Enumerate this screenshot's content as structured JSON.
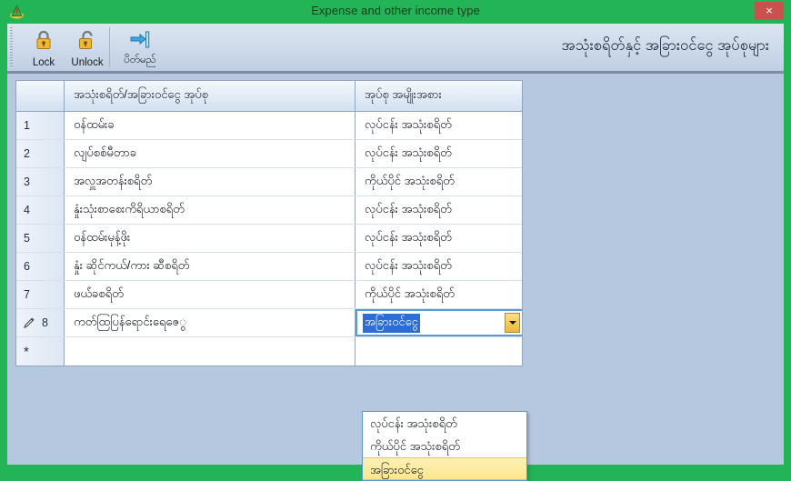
{
  "window": {
    "title": "Expense and other income type",
    "app_icon": "app-icon",
    "close_label": "×",
    "accent_green": "#22b455",
    "close_red": "#c9524f",
    "client_bg": "#b6c8e0"
  },
  "toolbar": {
    "items": [
      {
        "label": "Lock",
        "icon": "lock-closed-icon"
      },
      {
        "label": "Unlock",
        "icon": "lock-open-icon"
      },
      {
        "label": "ပိတ်မည်",
        "icon": "exit-door-icon"
      }
    ],
    "heading": "အသုံးစရိတ်နှင့် အခြားဝင်ငွေ အုပ်စုများ"
  },
  "grid": {
    "columns": [
      "",
      "အသုံးစရိတ်/အခြားဝင်ငွေ အုပ်စု",
      "အုပ်စု အမျိုးအစား"
    ],
    "rows": [
      {
        "num": "1",
        "name": "ဝန်ထမ်းခ",
        "type": "လုပ်ငန်း အသုံးစရိတ်",
        "state": "normal"
      },
      {
        "num": "2",
        "name": "လျပ်စစ်မီတာခ",
        "type": "လုပ်ငန်း အသုံးစရိတ်",
        "state": "normal"
      },
      {
        "num": "3",
        "name": "အလှူအတန်းစရိတ်",
        "type": "ကိုယ်ပိုင် အသုံးစရိတ်",
        "state": "normal"
      },
      {
        "num": "4",
        "name": "နှုံးသုံးစာစေးကိရိယာစရိတ်",
        "type": "လုပ်ငန်း အသုံးစရိတ်",
        "state": "normal"
      },
      {
        "num": "5",
        "name": "ဝန်ထမ်းမုန့်ဖိုး",
        "type": "လုပ်ငန်း အသုံးစရိတ်",
        "state": "normal"
      },
      {
        "num": "6",
        "name": "နှုံး ဆိုင်ကယ်/ကား ဆီစရိတ်",
        "type": "လုပ်ငန်း အသုံးစရိတ်",
        "state": "normal"
      },
      {
        "num": "7",
        "name": "ဖယ်ံခစရိတ်",
        "type": "ကိုယ်ပိုင် အသုံးစရိတ်",
        "state": "normal"
      },
      {
        "num": "8",
        "name": "ကတ်ထြပြန်ရောင်းရေဇေွ",
        "type": "",
        "state": "editing"
      },
      {
        "num": "*",
        "name": "",
        "type": "",
        "state": "new"
      }
    ]
  },
  "combo": {
    "value": "အခြားဝင်ငွေ",
    "arrow_icon": "chevron-down-icon",
    "options": [
      {
        "label": "လုပ်ငန်း အသုံးစရိတ်",
        "selected": false
      },
      {
        "label": "ကိုယ်ပိုင် အသုံးစရိတ်",
        "selected": false
      },
      {
        "label": "အခြားဝင်ငွေ",
        "selected": true
      }
    ]
  }
}
